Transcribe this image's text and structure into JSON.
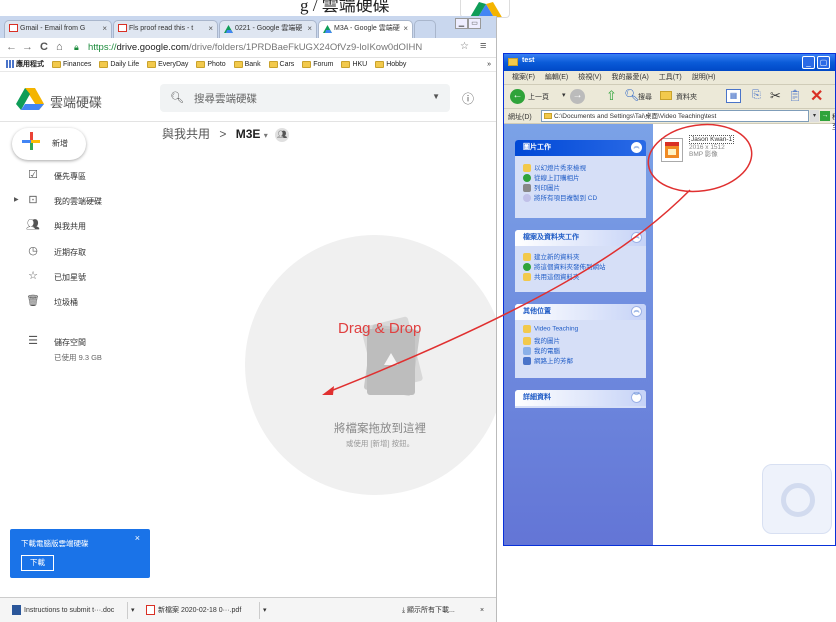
{
  "heading": {
    "text": "g / 雲端硬碟"
  },
  "chrome": {
    "tabs": [
      {
        "label": "Gmail - Email from G",
        "icon": "gmail-icon"
      },
      {
        "label": "Fls proof read this - t",
        "icon": "gmail-icon"
      },
      {
        "label": "0221 - Google 雲端硬",
        "icon": "drive-icon"
      },
      {
        "label": "M3A - Google 雲端硬",
        "icon": "drive-icon",
        "active": true
      }
    ],
    "tab_close": "×",
    "url_scheme": "https://",
    "url_host": "drive.google.com",
    "url_path": "/drive/folders/1PRDBaeFkUGX24OfVz9-loIKow0dOIHN",
    "bookmarks": [
      "應用程式",
      "Finances",
      "Daily Life",
      "EveryDay",
      "Photo",
      "Bank",
      "Cars",
      "Forum",
      "HKU",
      "Hobby"
    ],
    "bookmarks_more": "»"
  },
  "drive": {
    "product_name": "雲端硬碟",
    "search_placeholder": "搜尋雲端硬碟",
    "new_button": "新增",
    "sidebar": [
      {
        "label": "優先專區",
        "icon": "priority-icon"
      },
      {
        "label": "我的雲端硬碟",
        "icon": "my-drive-icon"
      },
      {
        "label": "與我共用",
        "icon": "shared-icon"
      },
      {
        "label": "近期存取",
        "icon": "recent-icon"
      },
      {
        "label": "已加星號",
        "icon": "star-icon"
      },
      {
        "label": "垃圾桶",
        "icon": "trash-icon"
      }
    ],
    "storage_label": "儲存空間",
    "storage_used": "已使用 9.3 GB",
    "breadcrumb_parent": "與我共用",
    "breadcrumb_sep": ">",
    "breadcrumb_current": "M3E",
    "drop_text": "將檔案拖放到這裡",
    "drop_subtext": "或使用 [新增] 按鈕。",
    "annotation": "Drag & Drop",
    "banner_text": "下載電腦版雲端硬碟",
    "banner_button": "下載",
    "banner_close": "×"
  },
  "downloads": {
    "items": [
      "Instructions to submit t···.doc",
      "新檔案 2020-02-18 0···.pdf"
    ],
    "show_all": "顯示所有下載...",
    "close": "×"
  },
  "xp": {
    "title": "test",
    "menu": [
      "檔案(F)",
      "編輯(E)",
      "檢視(V)",
      "我的最愛(A)",
      "工具(T)",
      "說明(H)"
    ],
    "toolbar_back": "上一頁",
    "toolbar_search": "搜尋",
    "toolbar_folders": "資料夾",
    "address_label": "網址(D)",
    "address": "C:\\Documents and Settings\\Tai\\桌面\\Video Teaching\\test",
    "go": "移至",
    "picture_tasks": {
      "header": "圖片工作",
      "items": [
        "以幻燈片秀來檢視",
        "從線上訂購相片",
        "列印圖片",
        "將所有項目複製到 CD"
      ]
    },
    "file_tasks": {
      "header": "檔案及資料夾工作",
      "items": [
        "建立新的資料夾",
        "將這個資料夾發佈到網站",
        "共用這個資料夾"
      ]
    },
    "other_places": {
      "header": "其他位置",
      "items": [
        "Video Teaching",
        "我的圖片",
        "我的電腦",
        "網路上的芳鄰"
      ]
    },
    "details": {
      "header": "詳細資料"
    },
    "file": {
      "name": "Jason Kwan-1",
      "dims": "2016 x 1512",
      "type": "BMP 影像"
    }
  },
  "colors": {
    "accent": "#1a73e8",
    "annotation": "#e04040",
    "xp_title": "#0a5bd8"
  }
}
